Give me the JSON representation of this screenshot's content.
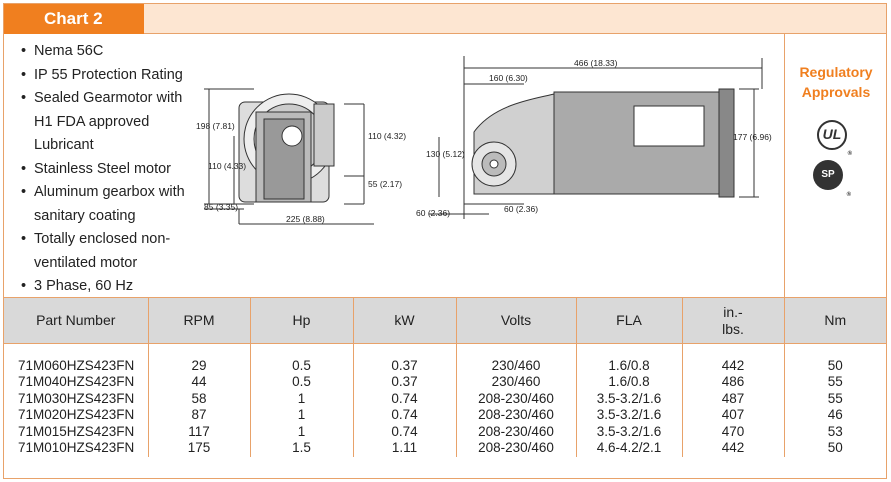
{
  "header": {
    "title": "Chart 2"
  },
  "features": [
    "Nema 56C",
    "IP 55 Protection Rating",
    "Sealed Gearmotor with H1 FDA approved Lubricant",
    "Stainless Steel motor",
    "Aluminum gearbox with sanitary coating",
    "Totally enclosed non-ventilated motor",
    "3 Phase, 60 Hz"
  ],
  "drawing": {
    "front_dims": {
      "height_total": "198 (7.81)",
      "center_height": "110 (4.33)",
      "right_height": "110 (4.32)",
      "shaft_height": "55 (2.17)",
      "base_offset": "85 (3.35)",
      "width": "225 (8.88)"
    },
    "side_dims": {
      "length": "466 (18.33)",
      "to_center": "160 (6.30)",
      "height": "177 (6.96)",
      "shaft_center": "130 (5.12)",
      "base_left": "60 (2.36)",
      "base_right": "60 (2.36)"
    }
  },
  "regulatory": {
    "title_line1": "Regulatory",
    "title_line2": "Approvals",
    "ul_label": "UL",
    "csa_label": "SP"
  },
  "table": {
    "headers": [
      "Part Number",
      "RPM",
      "Hp",
      "kW",
      "Volts",
      "FLA",
      "in.-",
      "lbs.",
      "Nm"
    ],
    "rows": [
      [
        "71M060HZS423FN",
        "29",
        "0.5",
        "0.37",
        "230/460",
        "1.6/0.8",
        "442",
        "50"
      ],
      [
        "71M040HZS423FN",
        "44",
        "0.5",
        "0.37",
        "230/460",
        "1.6/0.8",
        "486",
        "55"
      ],
      [
        "71M030HZS423FN",
        "58",
        "1",
        "0.74",
        "208-230/460",
        "3.5-3.2/1.6",
        "487",
        "55"
      ],
      [
        "71M020HZS423FN",
        "87",
        "1",
        "0.74",
        "208-230/460",
        "3.5-3.2/1.6",
        "407",
        "46"
      ],
      [
        "71M015HZS423FN",
        "117",
        "1",
        "0.74",
        "208-230/460",
        "3.5-3.2/1.6",
        "470",
        "53"
      ],
      [
        "71M010HZS423FN",
        "175",
        "1.5",
        "1.11",
        "208-230/460",
        "4.6-4.2/2.1",
        "442",
        "50"
      ]
    ]
  }
}
